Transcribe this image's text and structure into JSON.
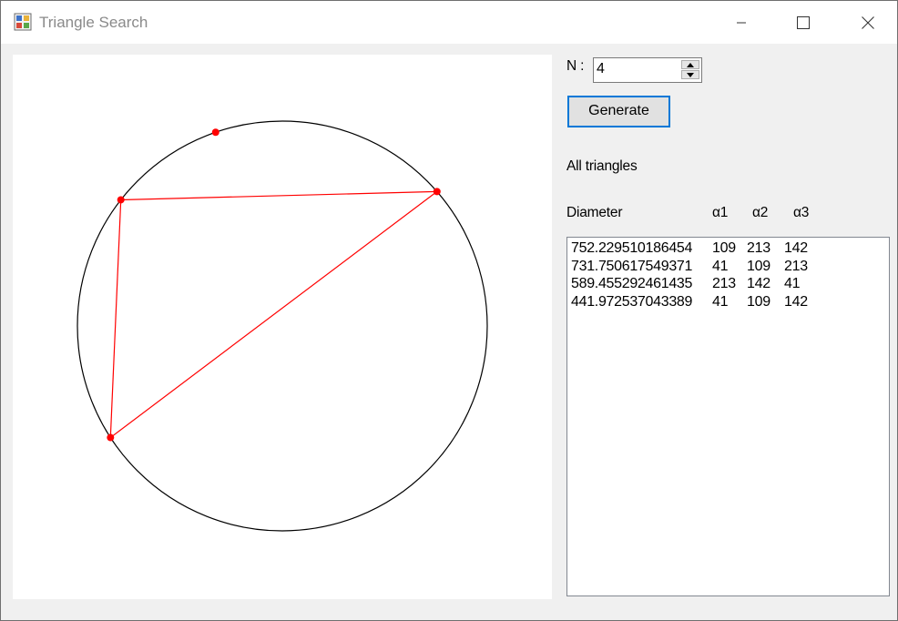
{
  "window": {
    "title": "Triangle Search",
    "minimize_glyph": "—",
    "maximize_glyph": "□",
    "close_glyph": "✕"
  },
  "controls": {
    "n_label": "N :",
    "n_value": "4",
    "generate_label": "Generate",
    "all_triangles_label": "All triangles"
  },
  "table": {
    "headers": [
      "Diameter",
      "α1",
      "α2",
      "α3"
    ],
    "rows": [
      [
        "752.229510186454",
        "109",
        "213",
        "142"
      ],
      [
        "731.750617549371",
        "41",
        "109",
        "213"
      ],
      [
        "589.455292461435",
        "213",
        "142",
        "41"
      ],
      [
        "441.972537043389",
        "41",
        "109",
        "142"
      ]
    ]
  },
  "diagram": {
    "circle_color": "#000000",
    "triangle_color": "#ff0000",
    "point_color": "#ff0000",
    "point_angles_deg": [
      109,
      213,
      142,
      41
    ],
    "triangle_point_indices": [
      1,
      2,
      3
    ]
  }
}
